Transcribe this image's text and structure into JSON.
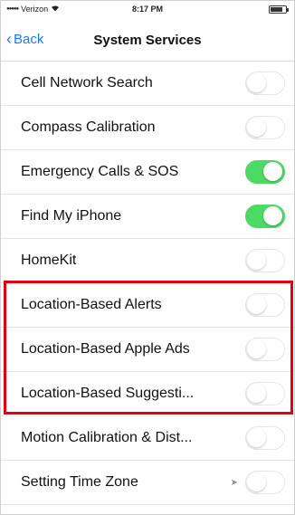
{
  "status_bar": {
    "carrier": "Verizon",
    "wifi_icon": "wifi-icon",
    "time": "8:17 PM",
    "battery_level": 0.7
  },
  "nav": {
    "back_label": "Back",
    "title": "System Services"
  },
  "rows": [
    {
      "label": "Cell Network Search",
      "on": false
    },
    {
      "label": "Compass Calibration",
      "on": false
    },
    {
      "label": "Emergency Calls & SOS",
      "on": true
    },
    {
      "label": "Find My iPhone",
      "on": true
    },
    {
      "label": "HomeKit",
      "on": false
    },
    {
      "label": "Location-Based Alerts",
      "on": false
    },
    {
      "label": "Location-Based Apple Ads",
      "on": false
    },
    {
      "label": "Location-Based Suggesti...",
      "on": false
    },
    {
      "label": "Motion Calibration & Dist...",
      "on": false
    },
    {
      "label": "Setting Time Zone",
      "on": false,
      "location_arrow": true
    }
  ],
  "colors": {
    "accent": "#1a7cf5",
    "toggle_on": "#4cd964",
    "highlight": "#e3000f"
  }
}
